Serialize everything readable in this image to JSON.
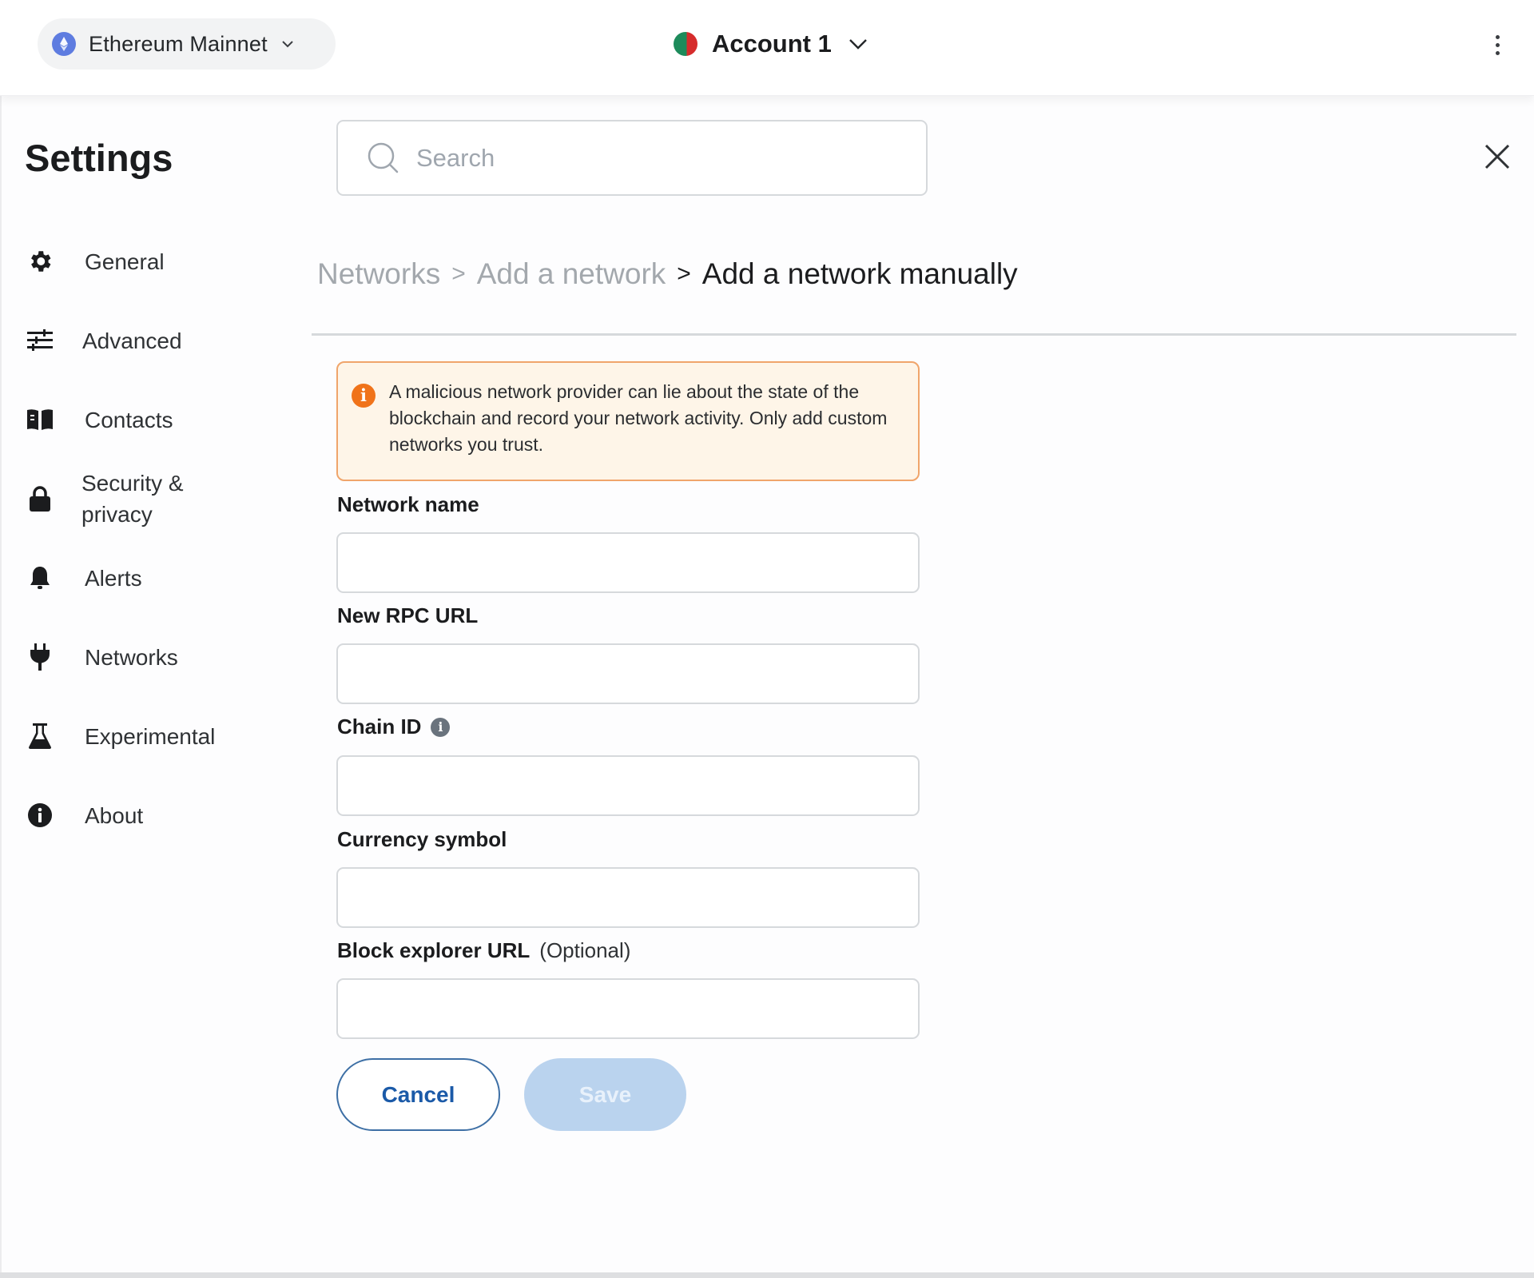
{
  "topbar": {
    "network": {
      "label": "Ethereum Mainnet",
      "icon": "ethereum-icon",
      "chevron": "chevron-down-icon"
    },
    "account": {
      "label": "Account 1",
      "icon": "account-avatar",
      "chevron": "chevron-down-icon"
    },
    "menu_icon": "kebab-menu-icon"
  },
  "sidebar": {
    "title": "Settings",
    "items": [
      {
        "label": "General",
        "icon": "gear-icon"
      },
      {
        "label": "Advanced",
        "icon": "sliders-icon"
      },
      {
        "label": "Contacts",
        "icon": "book-icon"
      },
      {
        "label": "Security &",
        "label_line2": "privacy",
        "icon": "lock-icon"
      },
      {
        "label": "Alerts",
        "icon": "bell-icon"
      },
      {
        "label": "Networks",
        "icon": "plug-icon"
      },
      {
        "label": "Experimental",
        "icon": "flask-icon"
      },
      {
        "label": "About",
        "icon": "info-icon"
      }
    ]
  },
  "search": {
    "placeholder": "Search",
    "value": ""
  },
  "breadcrumb": {
    "items": [
      "Networks",
      "Add a network"
    ],
    "current": "Add a network manually",
    "separator": ">"
  },
  "warning": {
    "text": "A malicious network provider can lie about the state of the blockchain and record your network activity. Only add custom networks you trust."
  },
  "form": {
    "fields": [
      {
        "label": "Network name",
        "value": ""
      },
      {
        "label": "New RPC URL",
        "value": ""
      },
      {
        "label": "Chain ID",
        "value": "",
        "has_info_icon": true
      },
      {
        "label": "Currency symbol",
        "value": ""
      },
      {
        "label": "Block explorer URL",
        "optional_label": "(Optional)",
        "value": ""
      }
    ],
    "cancel_label": "Cancel",
    "save_label": "Save",
    "save_enabled": false
  },
  "colors": {
    "accent": "#1b5aa8",
    "save_disabled": "#bad3ee",
    "warning_bg": "#fef5e8",
    "warning_border": "#f0a56b",
    "warning_icon": "#f0731a"
  }
}
